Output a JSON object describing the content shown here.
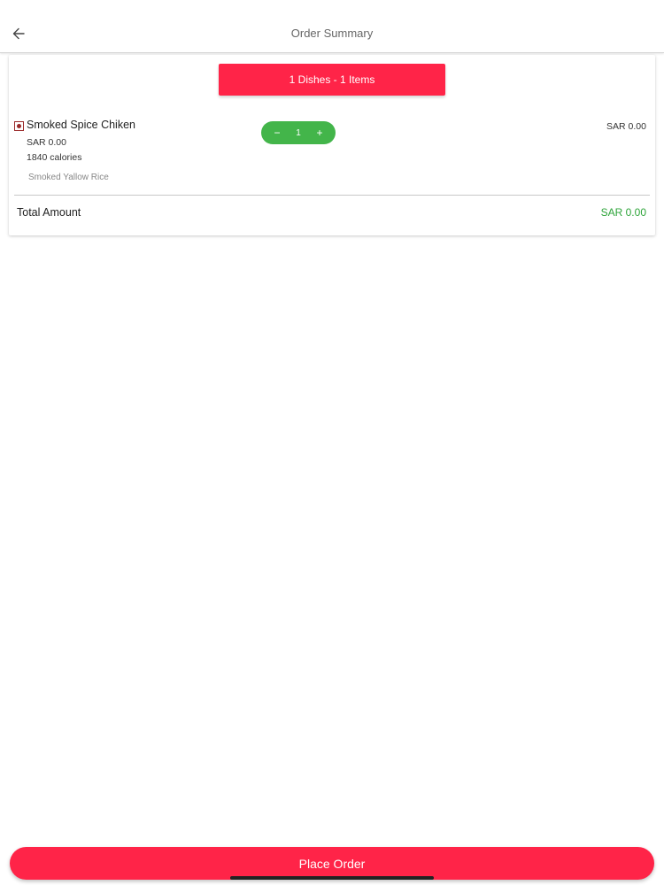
{
  "header": {
    "title": "Order Summary",
    "back_icon": "arrow-left-icon"
  },
  "summary": {
    "banner_text": "1 Dishes - 1 Items",
    "accent_color": "#ff2448"
  },
  "items": [
    {
      "name": "Smoked Spice Chiken",
      "price": "SAR 0.00",
      "calories": "1840 calories",
      "addon": "Smoked Yallow Rice",
      "quantity": "1",
      "line_total": "SAR 0.00",
      "decrement_label": "−",
      "increment_label": "+"
    }
  ],
  "totals": {
    "label": "Total Amount",
    "value": "SAR 0.00",
    "value_color": "#2ea43a"
  },
  "footer": {
    "place_order_label": "Place Order"
  }
}
